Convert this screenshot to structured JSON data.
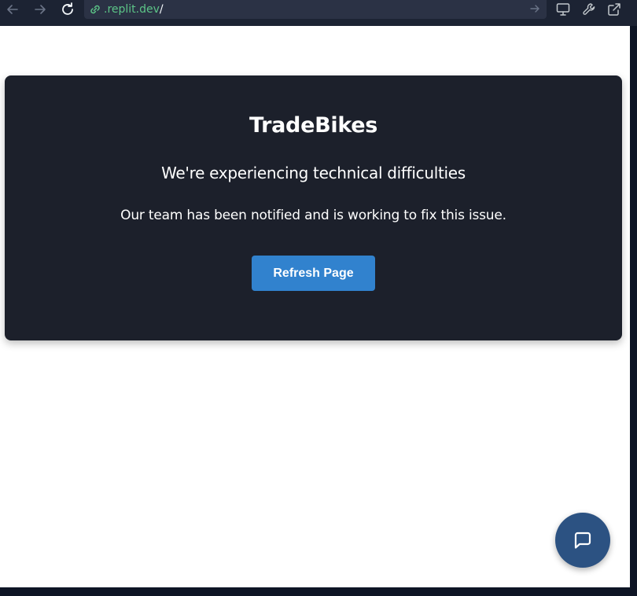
{
  "browser": {
    "url_host": ".replit.dev",
    "url_path": "/",
    "icons": {
      "back": "arrow-left-icon",
      "forward": "arrow-right-icon",
      "reload": "reload-icon",
      "link": "link-icon",
      "go": "arrow-right-icon",
      "devices": "monitor-icon",
      "devtools": "wrench-icon",
      "open_new": "external-link-icon"
    }
  },
  "error_card": {
    "title": "TradeBikes",
    "subtitle": "We're experiencing technical difficulties",
    "message": "Our team has been notified and is working to fix this issue.",
    "button_label": "Refresh Page"
  },
  "chat": {
    "icon": "chat-bubble-icon"
  },
  "colors": {
    "card_background": "#1c202b",
    "button": "#3182ce",
    "chat_fab": "#2c5282",
    "url_green": "#5cc487"
  }
}
